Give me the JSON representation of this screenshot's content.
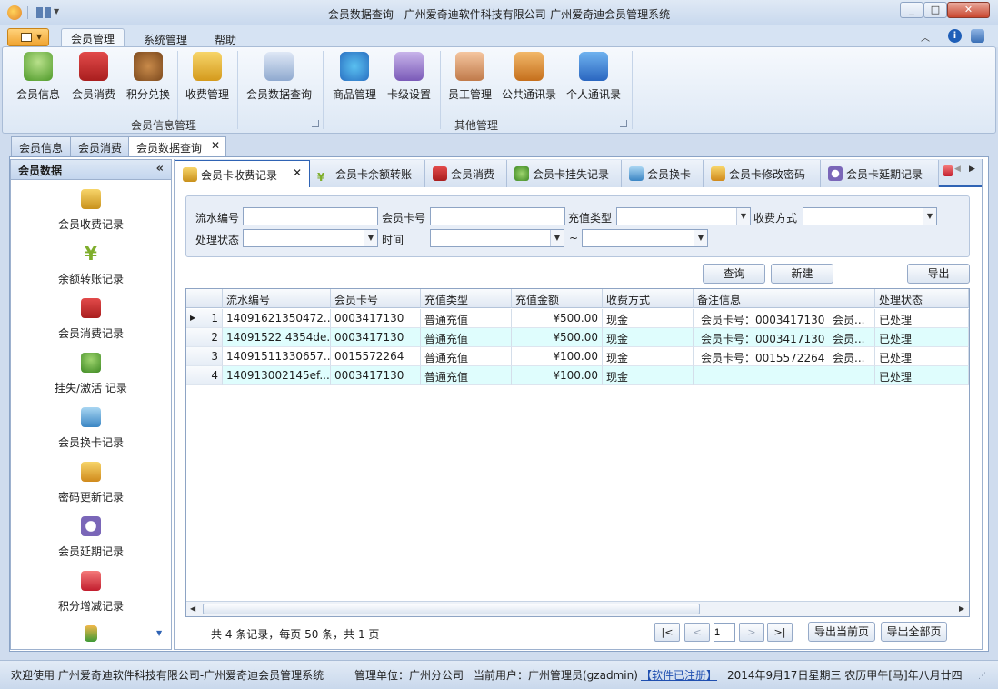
{
  "window": {
    "title": "会员数据查询 - 广州爱奇迪软件科技有限公司-广州爱奇迪会员管理系统"
  },
  "ribbon_tabs": [
    "会员管理",
    "系统管理",
    "帮助"
  ],
  "ribbon": {
    "group1": {
      "label": "会员信息管理",
      "buttons": [
        "会员信息",
        "会员消费",
        "积分兑换",
        "收费管理",
        "会员数据查询"
      ]
    },
    "group2": {
      "label": "其他管理",
      "buttons": [
        "商品管理",
        "卡级设置",
        "员工管理",
        "公共通讯录",
        "个人通讯录"
      ]
    }
  },
  "doc_tabs": [
    "会员信息",
    "会员消费",
    "会员数据查询"
  ],
  "left_nav": {
    "header": "会员数据",
    "items": [
      "会员收费记录",
      "余额转账记录",
      "会员消费记录",
      "挂失/激活 记录",
      "会员换卡记录",
      "密码更新记录",
      "会员延期记录",
      "积分增减记录"
    ]
  },
  "sub_tabs": [
    "会员卡收费记录",
    "会员卡余额转账",
    "会员消费",
    "会员卡挂失记录",
    "会员换卡",
    "会员卡修改密码",
    "会员卡延期记录"
  ],
  "filter": {
    "serial_label": "流水编号",
    "card_label": "会员卡号",
    "recharge_type_label": "充值类型",
    "pay_method_label": "收费方式",
    "status_label": "处理状态",
    "time_label": "时间",
    "range_sep": "~",
    "serial_value": "",
    "card_value": ""
  },
  "actions": {
    "query": "查询",
    "new": "新建",
    "export": "导出"
  },
  "table": {
    "columns": [
      "流水编号",
      "会员卡号",
      "充值类型",
      "充值金额",
      "收费方式",
      "备注信息",
      "处理状态"
    ],
    "rows": [
      {
        "n": "1",
        "serial": "14091621350472...",
        "card": "0003417130",
        "type": "普通充值",
        "amount": "¥500.00",
        "method": "现金",
        "note": "会员卡号：0003417130",
        "note2": "会员...",
        "status": "已处理"
      },
      {
        "n": "2",
        "serial": "14091522 4354de...",
        "card": "0003417130",
        "type": "普通充值",
        "amount": "¥500.00",
        "method": "现金",
        "note": "会员卡号：0003417130",
        "note2": "会员...",
        "status": "已处理"
      },
      {
        "n": "3",
        "serial": "14091511330657...",
        "card": "0015572264",
        "type": "普通充值",
        "amount": "¥100.00",
        "method": "现金",
        "note": "会员卡号：0015572264",
        "note2": "会员...",
        "status": "已处理"
      },
      {
        "n": "4",
        "serial": "140913002145ef...",
        "card": "0003417130",
        "type": "普通充值",
        "amount": "¥100.00",
        "method": "现金",
        "note": "",
        "note2": "",
        "status": "已处理"
      }
    ]
  },
  "pager": {
    "summary": "共 4 条记录，每页 50 条，共 1 页",
    "first": "|<",
    "prev": "<",
    "page": "1",
    "next": ">",
    "last": ">|",
    "export_page": "导出当前页",
    "export_all": "导出全部页"
  },
  "status": {
    "welcome": "欢迎使用 广州爱奇迪软件科技有限公司-广州爱奇迪会员管理系统",
    "unit": "管理单位：广州分公司",
    "user": "当前用户：广州管理员(gzadmin)",
    "registered": "【软件已注册】",
    "date": "2014年9月17日星期三 农历甲午[马]年八月廿四"
  },
  "colors": {
    "accent": "#2f63b4",
    "alt_row": "#dffdfd",
    "frame": "#cfdcee"
  }
}
